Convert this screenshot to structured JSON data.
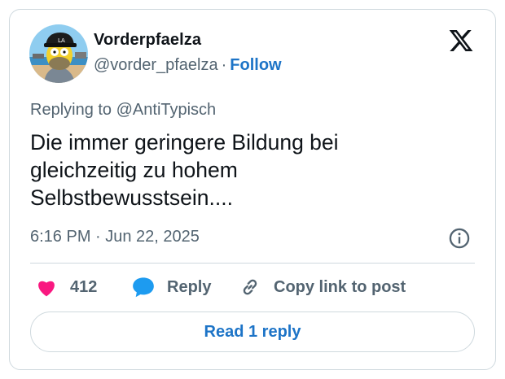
{
  "tweet": {
    "author_name": "Vorderpfaelza",
    "handle": "@vorder_pfaelza",
    "separator": "·",
    "follow_label": "Follow",
    "replying_to": "Replying to @AntiTypisch",
    "text": "Die immer geringere Bildung bei gleichzeitig zu hohem Selbstbewusstsein....",
    "timestamp": "6:16 PM · Jun 22, 2025"
  },
  "actions": {
    "like_count": "412",
    "reply_label": "Reply",
    "copy_label": "Copy link to post"
  },
  "read_replies_label": "Read 1 reply",
  "colors": {
    "link": "#1d74c7",
    "heart": "#f91880",
    "reply_bubble": "#1d9bf0",
    "muted": "#536471",
    "border": "#cfd9de"
  },
  "icons": {
    "brand": "x-logo-icon",
    "info": "info-icon",
    "like": "heart-icon",
    "reply": "speech-bubble-icon",
    "copy": "link-icon"
  }
}
